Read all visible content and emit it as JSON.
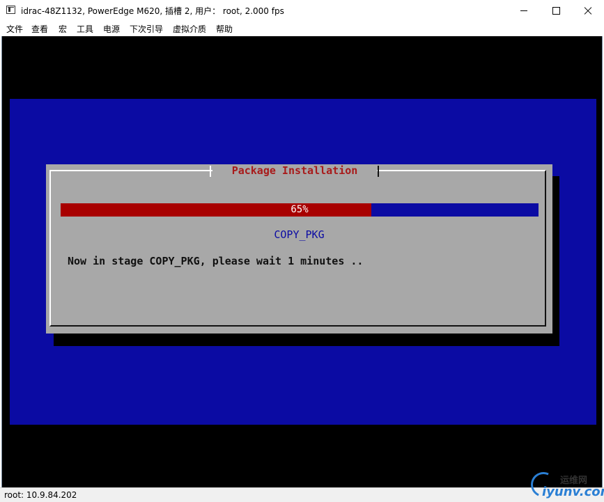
{
  "window": {
    "title": "idrac-48Z1132, PowerEdge M620, 插槽 2, 用户： root, 2.000 fps"
  },
  "menu": [
    "文件",
    "查看",
    "宏",
    "工具",
    "电源",
    "下次引导",
    "虚拟介质",
    "帮助"
  ],
  "dialog": {
    "title": "Package Installation",
    "progress_percent": 65,
    "progress_label": "65%",
    "stage": "COPY_PKG",
    "message": "Now in stage COPY_PKG, please wait 1 minutes .."
  },
  "status": {
    "text": "root: 10.9.84.202"
  },
  "watermark": {
    "cn": "运维网",
    "en": "iyunv.com"
  },
  "colors": {
    "console_bg": "#000000",
    "screen_blue": "#0b0ba3",
    "progress_red": "#a80000",
    "dialog_gray": "#a8a8a8",
    "title_red": "#a81b1b"
  }
}
